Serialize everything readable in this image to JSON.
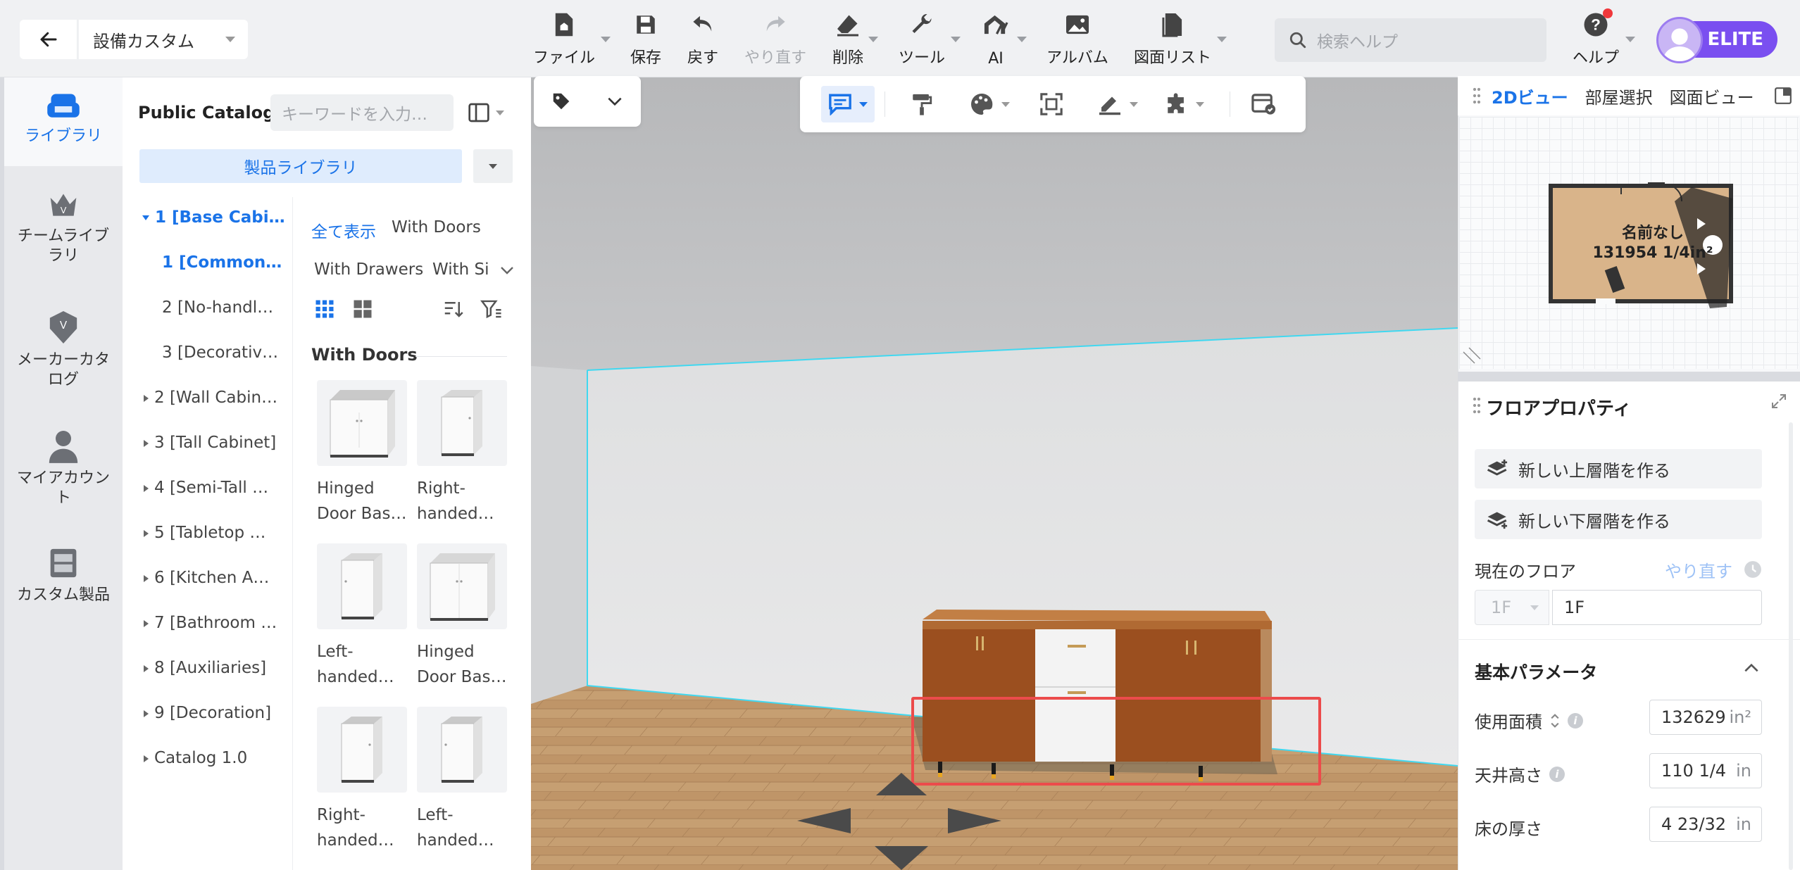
{
  "header": {
    "project_name": "設備カスタム",
    "toolbar": [
      {
        "label": "ファイル",
        "icon": "file-home-icon"
      },
      {
        "label": "保存",
        "icon": "save-icon"
      },
      {
        "label": "戻す",
        "icon": "undo-icon"
      },
      {
        "label": "やり直す",
        "icon": "redo-icon"
      },
      {
        "label": "削除",
        "icon": "eraser-icon"
      },
      {
        "label": "ツール",
        "icon": "wrench-icon"
      },
      {
        "label": "AI",
        "icon": "ai-house-icon"
      },
      {
        "label": "アルバム",
        "icon": "album-icon"
      },
      {
        "label": "図面リスト",
        "icon": "drawing-list-icon"
      }
    ],
    "search_placeholder": "検索ヘルプ",
    "help_label": "ヘルプ",
    "badge": "ELITE"
  },
  "rail": [
    {
      "label": "ライブラリ",
      "icon": "library-sofa-icon"
    },
    {
      "label": "チームライブラリ",
      "icon": "team-crown-icon"
    },
    {
      "label": "メーカーカタログ",
      "icon": "maker-badge-icon"
    },
    {
      "label": "マイアカウント",
      "icon": "account-icon"
    },
    {
      "label": "カスタム製品",
      "icon": "custom-cabinet-icon"
    }
  ],
  "catalog": {
    "title": "Public Catalog",
    "search_placeholder": "キーワードを入力…",
    "library_button": "製品ライブラリ",
    "tree": [
      "1 [Base Cabi…",
      "1 [Common…",
      "2 [No-handl…",
      "3 [Decorativ…",
      "2 [Wall Cabin…",
      "3 [Tall Cabinet]",
      "4 [Semi-Tall …",
      "5 [Tabletop …",
      "6 [Kitchen A…",
      "7 [Bathroom …",
      "8 [Auxiliaries]",
      "9 [Decoration]",
      "Catalog 1.0"
    ],
    "filters": [
      "全て表示",
      "With Doors",
      "With Drawers",
      "With Si"
    ],
    "section": "With Doors",
    "products": [
      {
        "line1": "Hinged",
        "line2": "Door Bas…"
      },
      {
        "line1": "Right-",
        "line2": "handed…"
      },
      {
        "line1": "Left-",
        "line2": "handed…"
      },
      {
        "line1": "Hinged",
        "line2": "Door Bas…"
      },
      {
        "line1": "Right-",
        "line2": "handed…"
      },
      {
        "line1": "Left-",
        "line2": "handed…"
      }
    ]
  },
  "minimap": {
    "tabs": [
      "2Dビュー",
      "部屋選択",
      "図面ビュー"
    ],
    "room_name": "名前なし",
    "room_area": "131954 1/4in²"
  },
  "floor_props": {
    "title": "フロアプロパティ",
    "add_upper": "新しい上層階を作る",
    "add_lower": "新しい下層階を作る",
    "current_floor_label": "現在のフロア",
    "redo_link": "やり直す",
    "floor_select": "1F",
    "floor_name": "1F",
    "basic_params": "基本パラメータ",
    "area_label": "使用面積",
    "area_value": "132629",
    "area_unit": "in²",
    "ceiling_label": "天井高さ",
    "ceiling_value": "110 1/4",
    "ceiling_unit": "in",
    "floor_thickness_label": "床の厚さ",
    "floor_thickness_value": "4 23/32",
    "floor_thickness_unit": "in"
  },
  "colors": {
    "accent": "#1a73e8",
    "elite": "#7a4ff0",
    "selection": "#ec4b4b",
    "wall_edge": "#40d8f0",
    "cabinet_wood": "#9b4f1f"
  }
}
